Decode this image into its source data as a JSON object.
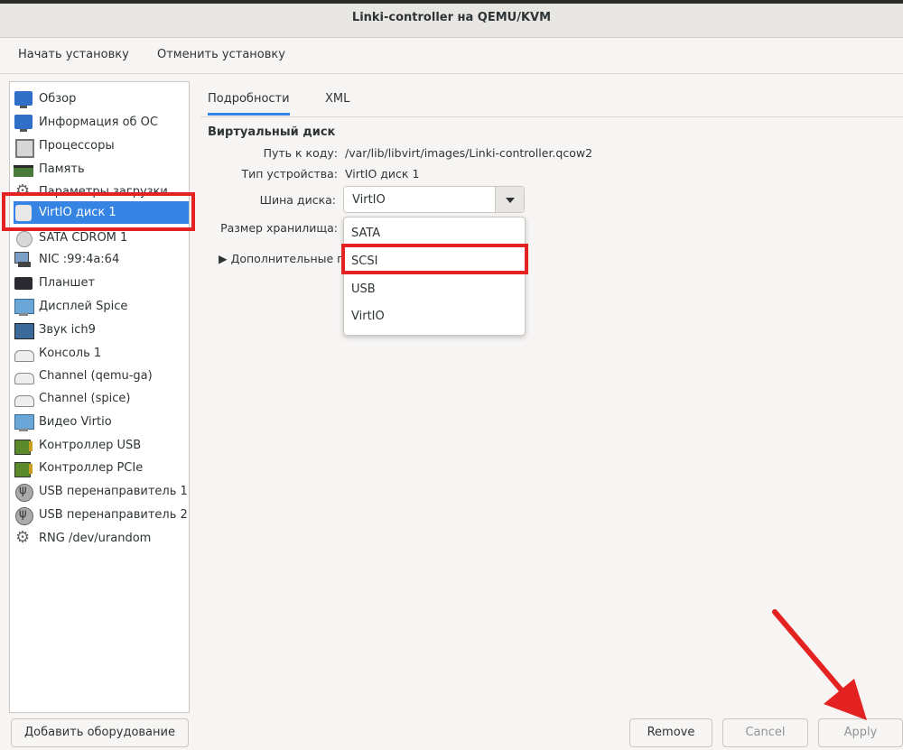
{
  "window": {
    "title": "Linki-controller на QEMU/KVM"
  },
  "menubar": {
    "begin_install": "Начать установку",
    "cancel_install": "Отменить установку"
  },
  "sidebar": {
    "items": [
      {
        "label": "Обзор",
        "icon": "monitor-icon"
      },
      {
        "label": "Информация об ОС",
        "icon": "monitor-icon"
      },
      {
        "label": "Процессоры",
        "icon": "cpu-icon"
      },
      {
        "label": "Память",
        "icon": "memory-icon"
      },
      {
        "label": "Параметры загрузки",
        "icon": "gears-icon"
      },
      {
        "label": "VirtIO диск 1",
        "icon": "disk-icon"
      },
      {
        "label": "SATA CDROM 1",
        "icon": "cdrom-icon"
      },
      {
        "label": "NIC :99:4a:64",
        "icon": "nic-icon"
      },
      {
        "label": "Планшет",
        "icon": "tablet-icon"
      },
      {
        "label": "Дисплей Spice",
        "icon": "display-icon"
      },
      {
        "label": "Звук ich9",
        "icon": "sound-icon"
      },
      {
        "label": "Консоль 1",
        "icon": "serial-icon"
      },
      {
        "label": "Channel (qemu-ga)",
        "icon": "serial-icon"
      },
      {
        "label": "Channel (spice)",
        "icon": "serial-icon"
      },
      {
        "label": "Видео Virtio",
        "icon": "video-icon"
      },
      {
        "label": "Контроллер USB",
        "icon": "controller-icon"
      },
      {
        "label": "Контроллер PCIe",
        "icon": "controller-icon"
      },
      {
        "label": "USB перенаправитель 1",
        "icon": "usb-icon"
      },
      {
        "label": "USB перенаправитель 2",
        "icon": "usb-icon"
      },
      {
        "label": "RNG /dev/urandom",
        "icon": "gears-icon"
      }
    ],
    "selected_index": 5
  },
  "tabs": [
    {
      "label": "Подробности"
    },
    {
      "label": "XML"
    }
  ],
  "details": {
    "section_title": "Виртуальный диск",
    "source_path_label": "Путь к коду:",
    "source_path_value": "/var/lib/libvirt/images/Linki-controller.qcow2",
    "device_type_label": "Тип устройства:",
    "device_type_value": "VirtIO диск 1",
    "disk_bus_label": "Шина диска:",
    "disk_bus_value": "VirtIO",
    "storage_size_label": "Размер хранилища:",
    "advanced_label": "Дополнительные п"
  },
  "bus_dropdown": {
    "options": [
      "SATA",
      "SCSI",
      "USB",
      "VirtIO"
    ],
    "highlighted": "SCSI"
  },
  "buttons": {
    "add_hardware": "Добавить оборудование",
    "remove": "Remove",
    "cancel": "Cancel",
    "apply": "Apply"
  },
  "colors": {
    "accent": "#3584e4",
    "highlight": "#e52222"
  }
}
